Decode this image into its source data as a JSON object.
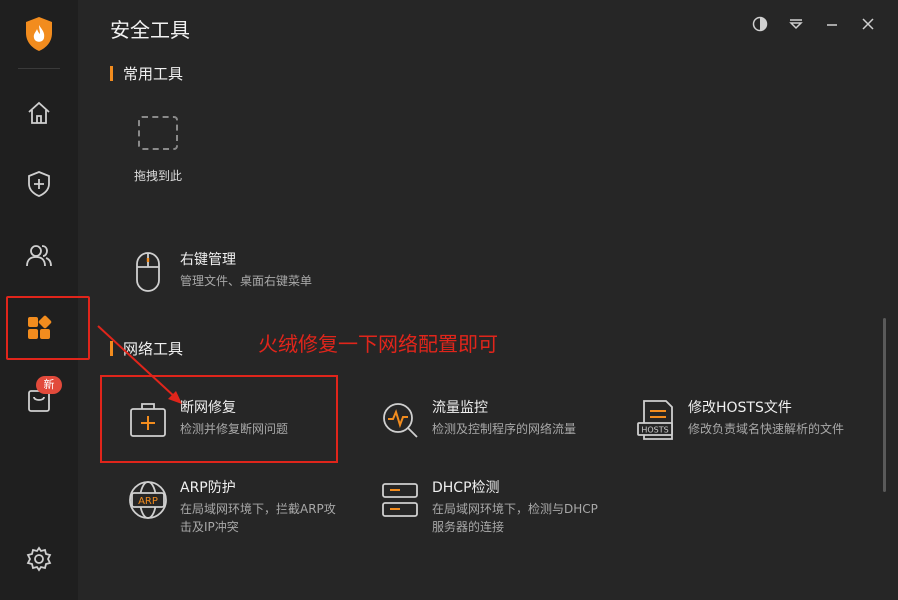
{
  "app": {
    "title": "安全工具"
  },
  "sidebar": {
    "items": [
      {
        "icon": "home-icon"
      },
      {
        "icon": "shield-plus-icon"
      },
      {
        "icon": "users-icon"
      },
      {
        "icon": "apps-icon"
      },
      {
        "icon": "bag-icon",
        "badge": "新"
      },
      {
        "icon": "gear-icon"
      }
    ],
    "accent": "#f28c1e"
  },
  "sections": {
    "common": {
      "label": "常用工具",
      "drop_slot_label": "拖拽到此",
      "tools": [
        {
          "name": "右键管理",
          "desc": "管理文件、桌面右键菜单",
          "icon": "mouse-icon"
        }
      ]
    },
    "network": {
      "label": "网络工具",
      "tools": [
        {
          "name": "断网修复",
          "desc": "检测并修复断网问题",
          "icon": "toolbox-plus-icon"
        },
        {
          "name": "流量监控",
          "desc": "检测及控制程序的网络流量",
          "icon": "traffic-monitor-icon"
        },
        {
          "name": "修改HOSTS文件",
          "desc": "修改负责域名快速解析的文件",
          "icon": "hosts-file-icon"
        },
        {
          "name": "ARP防护",
          "desc_lines": [
            "在局域网环境下，拦截ARP攻",
            "击及IP冲突"
          ],
          "icon": "arp-globe-icon"
        },
        {
          "name": "DHCP检测",
          "desc_lines": [
            "在局域网环境下，检测与DHCP",
            "服务器的连接"
          ],
          "icon": "dhcp-server-icon"
        }
      ]
    }
  },
  "annotation": {
    "text": "火绒修复一下网络配置即可",
    "color": "#e0251b"
  }
}
